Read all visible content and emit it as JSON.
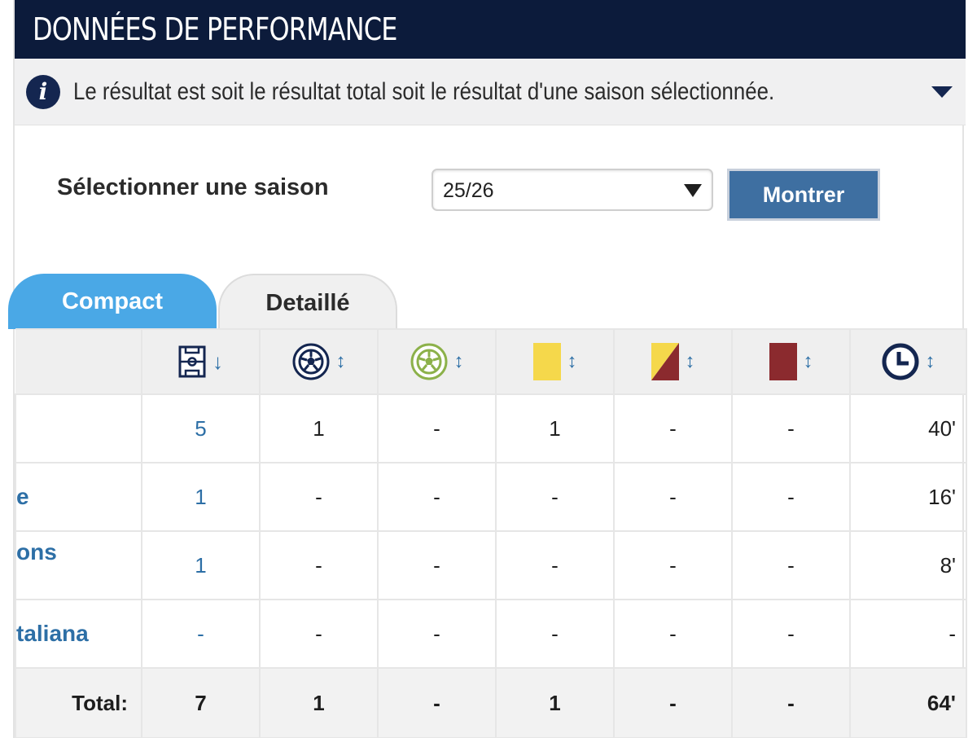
{
  "header": {
    "title": "DONNÉES DE PERFORMANCE"
  },
  "info": {
    "icon": "info-icon",
    "text": "Le résultat est soit le résultat total soit le résultat d'une saison sélectionnée."
  },
  "season": {
    "label": "Sélectionner une saison",
    "selected": "25/26",
    "button": "Montrer"
  },
  "tabs": [
    {
      "label": "Compact",
      "active": true
    },
    {
      "label": "Detaillé",
      "active": false
    }
  ],
  "table": {
    "columns": [
      {
        "icon": "pitch-icon",
        "sort": "↓"
      },
      {
        "icon": "goal-ball-icon",
        "sort": "↕"
      },
      {
        "icon": "assist-ball-icon",
        "sort": "↕"
      },
      {
        "icon": "yellow-card-icon",
        "sort": "↕"
      },
      {
        "icon": "yellow-red-card-icon",
        "sort": "↕"
      },
      {
        "icon": "red-card-icon",
        "sort": "↕"
      },
      {
        "icon": "minutes-clock-icon",
        "sort": "↕"
      }
    ],
    "rows": [
      {
        "competition": "",
        "apps": "5",
        "goals": "1",
        "assists": "-",
        "yellow": "1",
        "yellowred": "-",
        "red": "-",
        "minutes": "40'"
      },
      {
        "competition": "e",
        "apps": "1",
        "goals": "-",
        "assists": "-",
        "yellow": "-",
        "yellowred": "-",
        "red": "-",
        "minutes": "16'"
      },
      {
        "competition": "ons",
        "apps": "1",
        "goals": "-",
        "assists": "-",
        "yellow": "-",
        "yellowred": "-",
        "red": "-",
        "minutes": "8'"
      },
      {
        "competition": "taliana",
        "apps": "-",
        "goals": "-",
        "assists": "-",
        "yellow": "-",
        "yellowred": "-",
        "red": "-",
        "minutes": "-"
      }
    ],
    "total": {
      "label": "Total:",
      "apps": "7",
      "goals": "1",
      "assists": "-",
      "yellow": "1",
      "yellowred": "-",
      "red": "-",
      "minutes": "64'"
    }
  },
  "colors": {
    "header": "#0c1b3b",
    "accent": "#2d6fa6",
    "tab_active": "#4aa8e6",
    "button": "#3e6fa1",
    "yellow_card": "#f5d84b",
    "red_card": "#8b2a2e",
    "assist_green": "#8cb14a"
  }
}
